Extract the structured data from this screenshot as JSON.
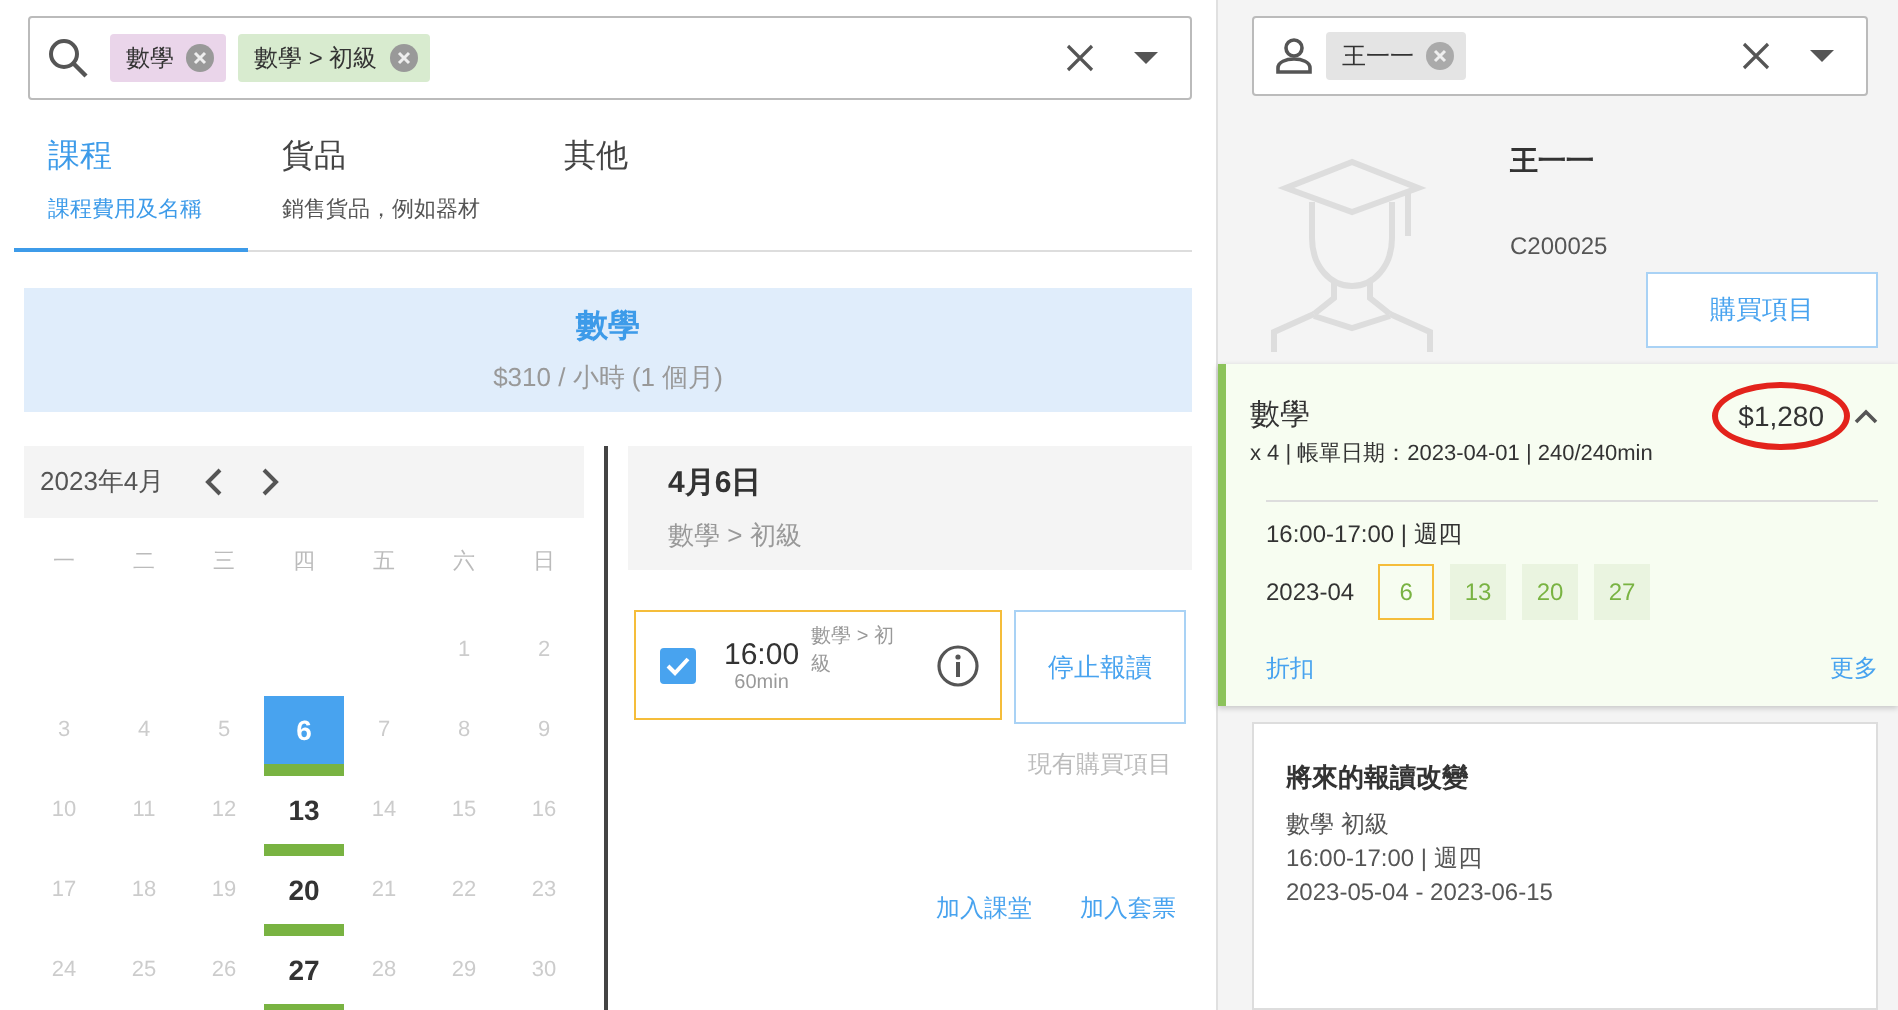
{
  "left_search": {
    "tags": [
      {
        "label": "數學",
        "color": "#ead5ea"
      },
      {
        "label": "數學 > 初級",
        "color": "#d8ebcf"
      }
    ]
  },
  "tabs": [
    {
      "label": "課程",
      "sublabel": "課程費用及名稱",
      "selected": true
    },
    {
      "label": "貨品",
      "sublabel": "銷售貨品，例如器材",
      "selected": false
    },
    {
      "label": "其他",
      "selected": false
    }
  ],
  "course_banner": {
    "title": "數學",
    "price": "$310 / 小時 (1 個月)"
  },
  "calendar": {
    "month": "2023年4月",
    "weekdays": [
      "一",
      "二",
      "三",
      "四",
      "五",
      "六",
      "日"
    ],
    "weeks": [
      [
        {
          "kind": "blank"
        },
        {
          "kind": "blank"
        },
        {
          "kind": "blank"
        },
        {
          "kind": "blank"
        },
        {
          "kind": "blank"
        },
        {
          "kind": "day",
          "label": "1",
          "has_class": false,
          "selected": false
        },
        {
          "kind": "day",
          "label": "2",
          "has_class": false,
          "selected": false
        }
      ],
      [
        {
          "kind": "day",
          "label": "3",
          "has_class": false,
          "selected": false
        },
        {
          "kind": "day",
          "label": "4",
          "has_class": false,
          "selected": false
        },
        {
          "kind": "day",
          "label": "5",
          "has_class": false,
          "selected": false
        },
        {
          "kind": "day",
          "label": "6",
          "has_class": true,
          "selected": true
        },
        {
          "kind": "day",
          "label": "7",
          "has_class": false,
          "selected": false
        },
        {
          "kind": "day",
          "label": "8",
          "has_class": false,
          "selected": false
        },
        {
          "kind": "day",
          "label": "9",
          "has_class": false,
          "selected": false
        }
      ],
      [
        {
          "kind": "day",
          "label": "10",
          "has_class": false,
          "selected": false
        },
        {
          "kind": "day",
          "label": "11",
          "has_class": false,
          "selected": false
        },
        {
          "kind": "day",
          "label": "12",
          "has_class": false,
          "selected": false
        },
        {
          "kind": "day",
          "label": "13",
          "has_class": true,
          "selected": false
        },
        {
          "kind": "day",
          "label": "14",
          "has_class": false,
          "selected": false
        },
        {
          "kind": "day",
          "label": "15",
          "has_class": false,
          "selected": false
        },
        {
          "kind": "day",
          "label": "16",
          "has_class": false,
          "selected": false
        }
      ],
      [
        {
          "kind": "day",
          "label": "17",
          "has_class": false,
          "selected": false
        },
        {
          "kind": "day",
          "label": "18",
          "has_class": false,
          "selected": false
        },
        {
          "kind": "day",
          "label": "19",
          "has_class": false,
          "selected": false
        },
        {
          "kind": "day",
          "label": "20",
          "has_class": true,
          "selected": false
        },
        {
          "kind": "day",
          "label": "21",
          "has_class": false,
          "selected": false
        },
        {
          "kind": "day",
          "label": "22",
          "has_class": false,
          "selected": false
        },
        {
          "kind": "day",
          "label": "23",
          "has_class": false,
          "selected": false
        }
      ],
      [
        {
          "kind": "day",
          "label": "24",
          "has_class": false,
          "selected": false
        },
        {
          "kind": "day",
          "label": "25",
          "has_class": false,
          "selected": false
        },
        {
          "kind": "day",
          "label": "26",
          "has_class": false,
          "selected": false
        },
        {
          "kind": "day",
          "label": "27",
          "has_class": true,
          "selected": false
        },
        {
          "kind": "day",
          "label": "28",
          "has_class": false,
          "selected": false
        },
        {
          "kind": "day",
          "label": "29",
          "has_class": false,
          "selected": false
        },
        {
          "kind": "day",
          "label": "30",
          "has_class": false,
          "selected": false
        }
      ]
    ]
  },
  "day_detail": {
    "date": "4月6日",
    "course": "數學 > 初級",
    "session": {
      "time": "16:00",
      "duration": "60min",
      "course": "數學 > 初級",
      "checked": true
    },
    "stop_button": "停止報讀",
    "existing_label": "現有購買項目",
    "links": [
      "加入課堂",
      "加入套票"
    ]
  },
  "student_search": {
    "tags": [
      {
        "label": "王一一",
        "color": "#e4e4e4"
      }
    ]
  },
  "student": {
    "name": "王一一",
    "id": "C200025",
    "buy_button": "購買項目"
  },
  "purchase": {
    "title": "數學",
    "price": "$1,280",
    "highlighted": true,
    "expanded": true,
    "details": "x 4 | 帳單日期：2023-04-01 | 240/240min",
    "schedule": "16:00-17:00 | 週四",
    "month": "2023-04",
    "dates": [
      {
        "label": "6",
        "selected": true
      },
      {
        "label": "13",
        "selected": false
      },
      {
        "label": "20",
        "selected": false
      },
      {
        "label": "27",
        "selected": false
      }
    ],
    "links": [
      "折扣",
      "更多"
    ]
  },
  "future_changes": {
    "title": "將來的報讀改變",
    "lines": [
      "數學 初級",
      "16:00-17:00 | 週四",
      "2023-05-04 - 2023-06-15"
    ]
  }
}
